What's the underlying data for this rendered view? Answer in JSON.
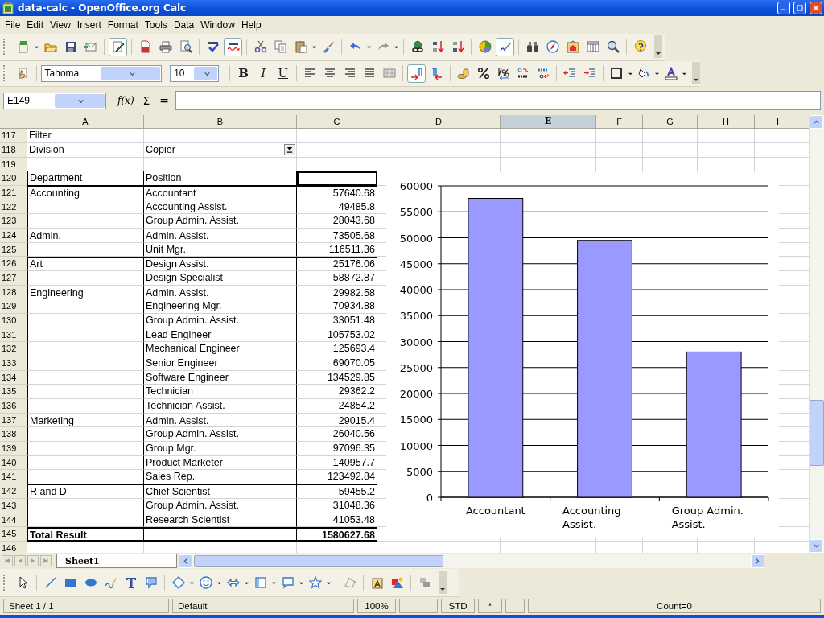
{
  "window": {
    "title": "data-calc - OpenOffice.org Calc"
  },
  "menu": [
    "File",
    "Edit",
    "View",
    "Insert",
    "Format",
    "Tools",
    "Data",
    "Window",
    "Help"
  ],
  "formatting": {
    "font_name": "Tahoma",
    "font_size": "10",
    "style_buttons": [
      "B",
      "I",
      "U"
    ]
  },
  "formula_bar": {
    "name_box": "E149",
    "function_label": "f(x)",
    "sum_label": "Σ",
    "equals_label": "="
  },
  "columns": [
    {
      "label": "A",
      "selected": false
    },
    {
      "label": "B",
      "selected": false
    },
    {
      "label": "C",
      "selected": false
    },
    {
      "label": "D",
      "selected": false
    },
    {
      "label": "E",
      "selected": true
    },
    {
      "label": "F",
      "selected": false
    },
    {
      "label": "G",
      "selected": false
    },
    {
      "label": "H",
      "selected": false
    },
    {
      "label": "I",
      "selected": false
    }
  ],
  "rows": [
    {
      "number": "117",
      "kind": "plain",
      "cells": {
        "a": "Filter"
      }
    },
    {
      "number": "118",
      "kind": "filter",
      "cells": {
        "a": "Division",
        "b": "Copier"
      }
    },
    {
      "number": "119",
      "kind": "plain",
      "cells": {}
    },
    {
      "number": "120",
      "kind": "header",
      "cells": {
        "a": "Department",
        "b": "Position"
      }
    },
    {
      "number": "121",
      "kind": "data",
      "cells": {
        "a": "Accounting",
        "b": "Accountant",
        "c": "57640.68"
      }
    },
    {
      "number": "122",
      "kind": "data",
      "cells": {
        "b": "Accounting Assist.",
        "c": "49485.8"
      }
    },
    {
      "number": "123",
      "kind": "data",
      "cells": {
        "b": "Group Admin. Assist.",
        "c": "28043.68"
      }
    },
    {
      "number": "124",
      "kind": "data",
      "cells": {
        "a": "Admin.",
        "b": "Admin. Assist.",
        "c": "73505.68"
      }
    },
    {
      "number": "125",
      "kind": "data",
      "cells": {
        "b": "Unit Mgr.",
        "c": "116511.36"
      }
    },
    {
      "number": "126",
      "kind": "data",
      "cells": {
        "a": "Art",
        "b": "Design Assist.",
        "c": "25176.06"
      }
    },
    {
      "number": "127",
      "kind": "data",
      "cells": {
        "b": "Design Specialist",
        "c": "58872.87"
      }
    },
    {
      "number": "128",
      "kind": "data",
      "cells": {
        "a": "Engineering",
        "b": "Admin. Assist.",
        "c": "29982.58"
      }
    },
    {
      "number": "129",
      "kind": "data",
      "cells": {
        "b": "Engineering Mgr.",
        "c": "70934.88"
      }
    },
    {
      "number": "130",
      "kind": "data",
      "cells": {
        "b": "Group Admin. Assist.",
        "c": "33051.48"
      }
    },
    {
      "number": "131",
      "kind": "data",
      "cells": {
        "b": "Lead Engineer",
        "c": "105753.02"
      }
    },
    {
      "number": "132",
      "kind": "data",
      "cells": {
        "b": "Mechanical Engineer",
        "c": "125693.4"
      }
    },
    {
      "number": "133",
      "kind": "data",
      "cells": {
        "b": "Senior Engineer",
        "c": "69070.05"
      }
    },
    {
      "number": "134",
      "kind": "data",
      "cells": {
        "b": "Software Engineer",
        "c": "134529.85"
      }
    },
    {
      "number": "135",
      "kind": "data",
      "cells": {
        "b": "Technician",
        "c": "29362.2"
      }
    },
    {
      "number": "136",
      "kind": "data",
      "cells": {
        "b": "Technician Assist.",
        "c": "24854.2"
      }
    },
    {
      "number": "137",
      "kind": "data",
      "cells": {
        "a": "Marketing",
        "b": "Admin. Assist.",
        "c": "29015.4"
      }
    },
    {
      "number": "138",
      "kind": "data",
      "cells": {
        "b": "Group Admin. Assist.",
        "c": "26040.56"
      }
    },
    {
      "number": "139",
      "kind": "data",
      "cells": {
        "b": "Group Mgr.",
        "c": "97096.35"
      }
    },
    {
      "number": "140",
      "kind": "data",
      "cells": {
        "b": "Product Marketer",
        "c": "140957.7"
      }
    },
    {
      "number": "141",
      "kind": "data",
      "cells": {
        "b": "Sales Rep.",
        "c": "123492.84"
      }
    },
    {
      "number": "142",
      "kind": "data",
      "cells": {
        "a": "R and D",
        "b": "Chief Scientist",
        "c": "59455.2"
      }
    },
    {
      "number": "143",
      "kind": "data",
      "cells": {
        "b": "Group Admin. Assist.",
        "c": "31048.36"
      }
    },
    {
      "number": "144",
      "kind": "data",
      "cells": {
        "b": "Research Scientist",
        "c": "41053.48"
      }
    },
    {
      "number": "145",
      "kind": "total",
      "cells": {
        "a": "Total Result",
        "c": "1580627.68"
      }
    },
    {
      "number": "146",
      "kind": "plain",
      "cells": {}
    }
  ],
  "chart": {
    "chart_data": {
      "type": "bar",
      "categories": [
        "Accountant",
        "Accounting Assist.",
        "Group Admin. Assist."
      ],
      "series": [
        {
          "color": "#9999ff",
          "values": [
            57600,
            49500,
            28000
          ]
        }
      ],
      "grid": true,
      "ylim": [
        0,
        60000
      ],
      "yticks": [
        0,
        5000,
        10000,
        15000,
        20000,
        25000,
        30000,
        35000,
        40000,
        45000,
        50000,
        55000,
        60000
      ]
    }
  },
  "sheet_tabs": [
    {
      "label": "Sheet1",
      "selected": true
    }
  ],
  "status_bar": [
    "Sheet 1 / 1",
    "Default",
    "100%",
    "STD",
    "*",
    "Count=0"
  ]
}
